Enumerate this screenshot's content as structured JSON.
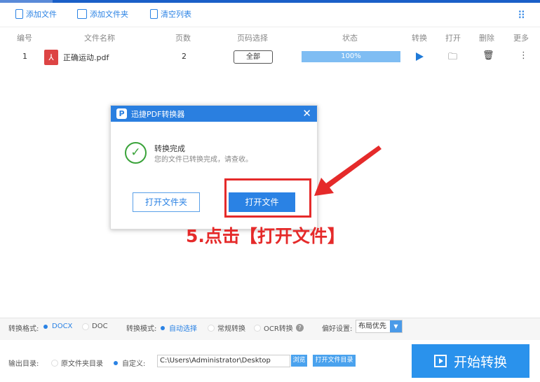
{
  "toolbar": {
    "add_file": "添加文件",
    "add_folder": "添加文件夹",
    "clear_list": "清空列表"
  },
  "table": {
    "headers": [
      "编号",
      "文件名称",
      "页数",
      "页码选择",
      "状态",
      "转换",
      "打开",
      "删除",
      "更多"
    ],
    "rows": [
      {
        "index": "1",
        "name": "正确运动.pdf",
        "pages": "2",
        "page_select": "全部",
        "progress": 100,
        "progress_label": "100%"
      }
    ]
  },
  "options": {
    "format_label": "转换格式:",
    "format_docx": "DOCX",
    "format_doc": "DOC",
    "mode_label": "转换模式:",
    "mode_auto": "自动选择",
    "mode_normal": "常规转换",
    "mode_ocr": "OCR转换",
    "pref_label": "偏好设置:",
    "pref_value": "布局优先"
  },
  "output": {
    "label": "输出目录:",
    "original": "原文件夹目录",
    "custom": "自定义:",
    "path": "C:\\Users\\Administrator\\Desktop",
    "browse": "浏览",
    "open_dir": "打开文件目录"
  },
  "start_label": "开始转换",
  "dialog": {
    "title": "迅捷PDF转换器",
    "heading": "转换完成",
    "message": "您的文件已转换完成，请查收。",
    "open_folder": "打开文件夹",
    "open_file": "打开文件"
  },
  "annotation": "5.点击【打开文件】",
  "colors": {
    "accent": "#2a82e4",
    "annotation": "#e52a2a"
  }
}
